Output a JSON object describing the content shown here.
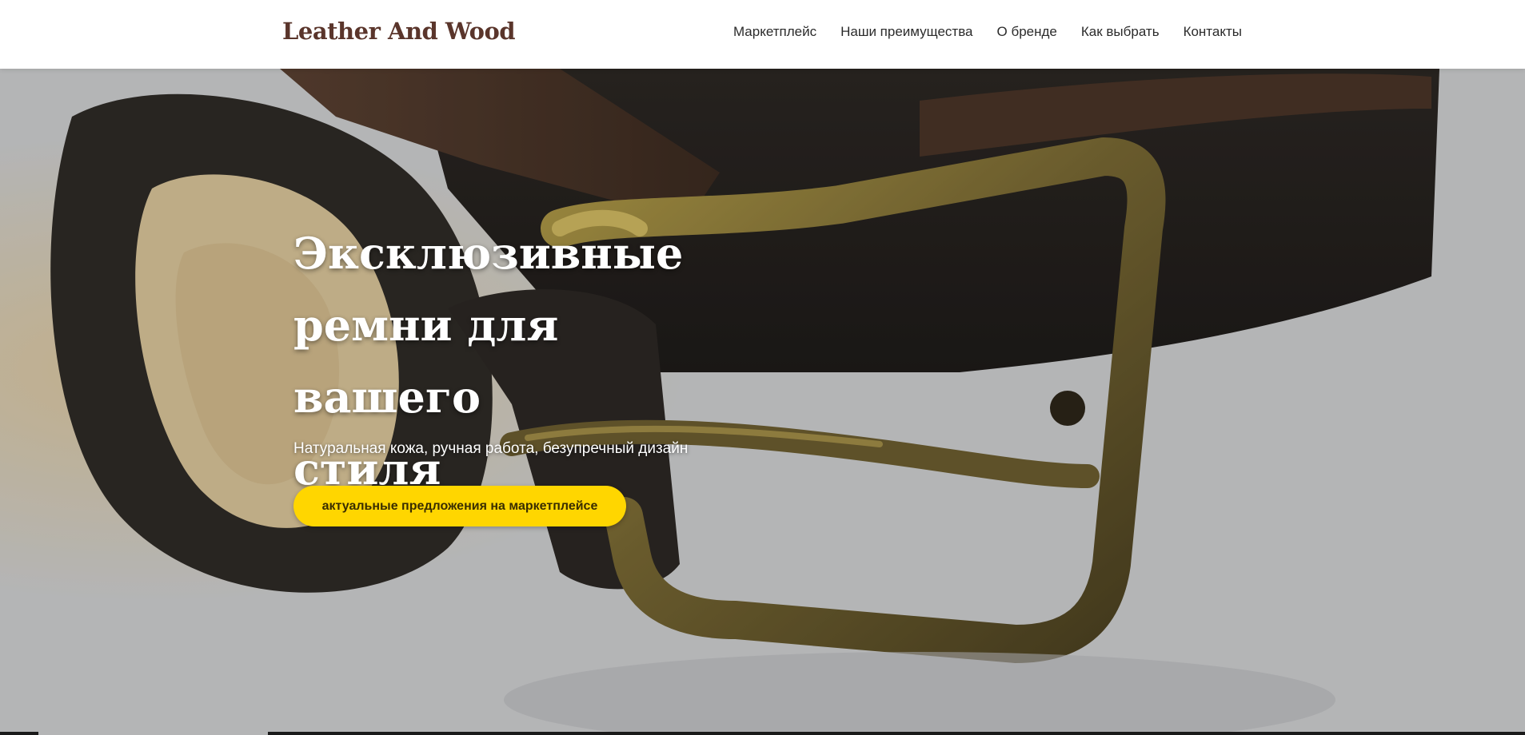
{
  "header": {
    "logo": "Leather And Wood",
    "nav": [
      {
        "label": "Маркетплейс"
      },
      {
        "label": "Наши преимущества"
      },
      {
        "label": "О бренде"
      },
      {
        "label": "Как выбрать"
      },
      {
        "label": "Контакты"
      }
    ]
  },
  "hero": {
    "image": "leather-belt-brass-buckle-photo",
    "title_lines": [
      "Эксклюзивные",
      "ремни для вашего",
      "стиля"
    ],
    "subtitle": "Натуральная кожа, ручная работа, безупречный дизайн",
    "cta_label": "актуальные предложения на маркетплейсе"
  },
  "colors": {
    "logo": "#5a352b",
    "cta_background": "#ffd600",
    "header_background": "#ffffff",
    "hero_text": "#ffffff"
  }
}
